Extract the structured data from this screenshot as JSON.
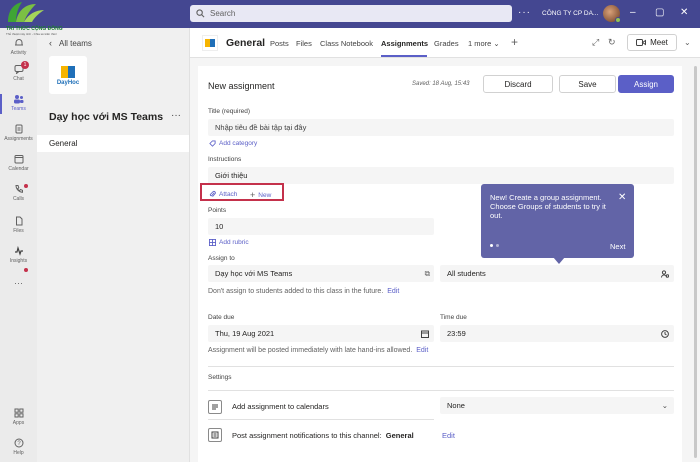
{
  "branding": {
    "watermark_line1": "TRI THỨC CỘNG ĐỒNG",
    "watermark_line2": "Thủ thuật máy tính - Chia sẻ kiến thức"
  },
  "titlebar": {
    "search_placeholder": "Search",
    "more": "···",
    "company": "CÔNG TY CP DA...",
    "minimize": "–",
    "maximize": "▢",
    "close": "✕"
  },
  "rail": {
    "items": [
      {
        "label": "Activity",
        "icon": "bell-icon"
      },
      {
        "label": "Chat",
        "icon": "chat-icon",
        "badge": "1"
      },
      {
        "label": "Teams",
        "icon": "teams-icon"
      },
      {
        "label": "Assignments",
        "icon": "assignments-icon"
      },
      {
        "label": "Calendar",
        "icon": "calendar-icon"
      },
      {
        "label": "Calls",
        "icon": "phone-icon"
      },
      {
        "label": "Files",
        "icon": "file-icon"
      },
      {
        "label": "Insights",
        "icon": "insights-icon"
      },
      {
        "label": "···",
        "icon": "more-icon"
      },
      {
        "label": "Apps",
        "icon": "apps-icon"
      },
      {
        "label": "Help",
        "icon": "help-icon"
      }
    ]
  },
  "teampanel": {
    "back_label": "All teams",
    "logo_text": "DayHoc",
    "team_name": "Dạy học với MS Teams",
    "more": "···",
    "channel": "General"
  },
  "header": {
    "title": "General",
    "tabs": [
      "Posts",
      "Files",
      "Class Notebook",
      "Assignments",
      "Grades",
      "1 more ⌄"
    ],
    "active_tab": "Assignments",
    "plus": "+",
    "meet_label": "Meet",
    "meet_chevron": "⌄"
  },
  "form": {
    "heading": "New assignment",
    "saved_text": "Saved: 18 Aug, 15:43",
    "discard_label": "Discard",
    "save_label": "Save",
    "assign_label": "Assign",
    "title_label": "Title (required)",
    "title_placeholder": "Nhập tiêu đề bài tập tại đây",
    "add_category": "Add category",
    "instructions_label": "Instructions",
    "instructions_value": "Giới thiệu",
    "attach_label": "Attach",
    "new_label": "New",
    "points_label": "Points",
    "points_value": "10",
    "add_rubric": "Add rubric",
    "assign_to_label": "Assign to",
    "assign_to_class": "Dạy học với MS Teams",
    "assign_to_students": "All students",
    "dont_assign_text": "Don't assign to students added to this class in the future.",
    "edit_label": "Edit",
    "date_due_label": "Date due",
    "date_due_value": "Thu, 19 Aug 2021",
    "time_due_label": "Time due",
    "time_due_value": "23:59",
    "posted_text": "Assignment will be posted immediately with late hand-ins allowed.",
    "settings_label": "Settings",
    "calendar_setting": "Add assignment to calendars",
    "calendar_value": "None",
    "notify_setting": "Post assignment notifications to this channel:",
    "notify_channel": "General"
  },
  "tooltip": {
    "text": "New! Create a group assignment. Choose Groups of students to try it out.",
    "close": "✕",
    "next": "Next"
  },
  "colors": {
    "brand": "#444791",
    "accent": "#5b5fc7",
    "tooltip": "#6264a7",
    "highlight_box": "#c4314b"
  }
}
